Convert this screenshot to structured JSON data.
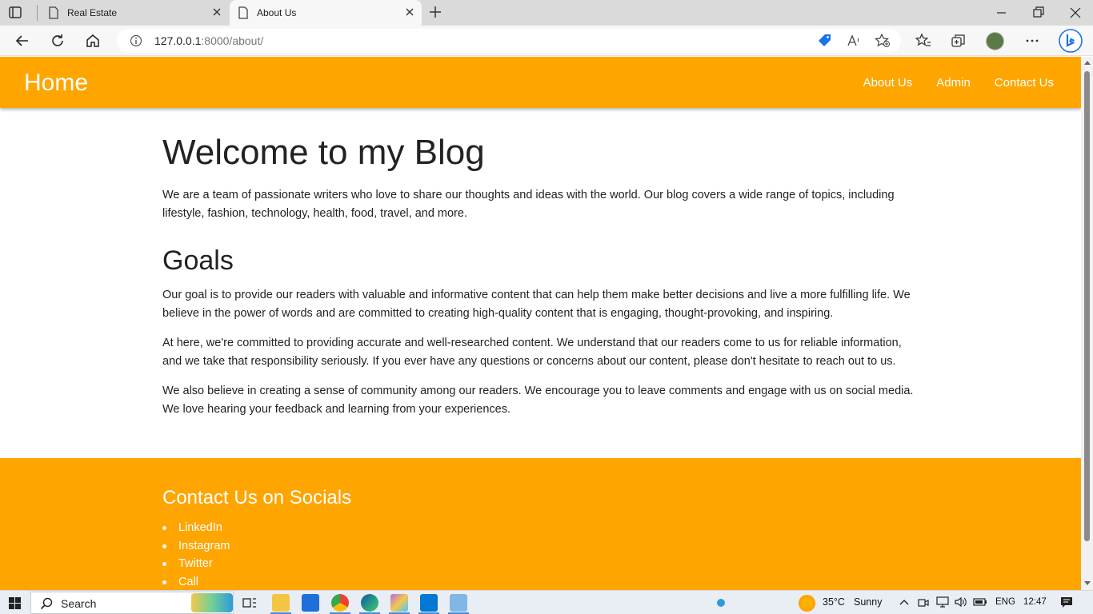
{
  "browser": {
    "tabs": [
      {
        "title": "Real Estate",
        "active": false
      },
      {
        "title": "About Us",
        "active": true
      }
    ],
    "url_host": "127.0.0.1",
    "url_rest": ":8000/about/"
  },
  "site": {
    "brand": "Home",
    "nav": [
      "About Us",
      "Admin",
      "Contact Us"
    ],
    "accent_color": "#ffa500"
  },
  "main": {
    "heading": "Welcome to my Blog",
    "intro": "We are a team of passionate writers who love to share our thoughts and ideas with the world. Our blog covers a wide range of topics, including lifestyle, fashion, technology, health, food, travel, and more.",
    "goals_heading": "Goals",
    "paragraphs": [
      "Our goal is to provide our readers with valuable and informative content that can help them make better decisions and live a more fulfilling life. We believe in the power of words and are committed to creating high-quality content that is engaging, thought-provoking, and inspiring.",
      "At here, we're committed to providing accurate and well-researched content. We understand that our readers come to us for reliable information, and we take that responsibility seriously. If you ever have any questions or concerns about our content, please don't hesitate to reach out to us.",
      "We also believe in creating a sense of community among our readers. We encourage you to leave comments and engage with us on social media. We love hearing your feedback and learning from your experiences."
    ]
  },
  "footer": {
    "title": "Contact Us on Socials",
    "links": [
      "LinkedIn",
      "Instagram",
      "Twitter",
      "Call"
    ]
  },
  "taskbar": {
    "search_label": "Search",
    "weather_temp": "35°C",
    "weather_desc": "Sunny",
    "language": "ENG",
    "time": "12:47"
  }
}
